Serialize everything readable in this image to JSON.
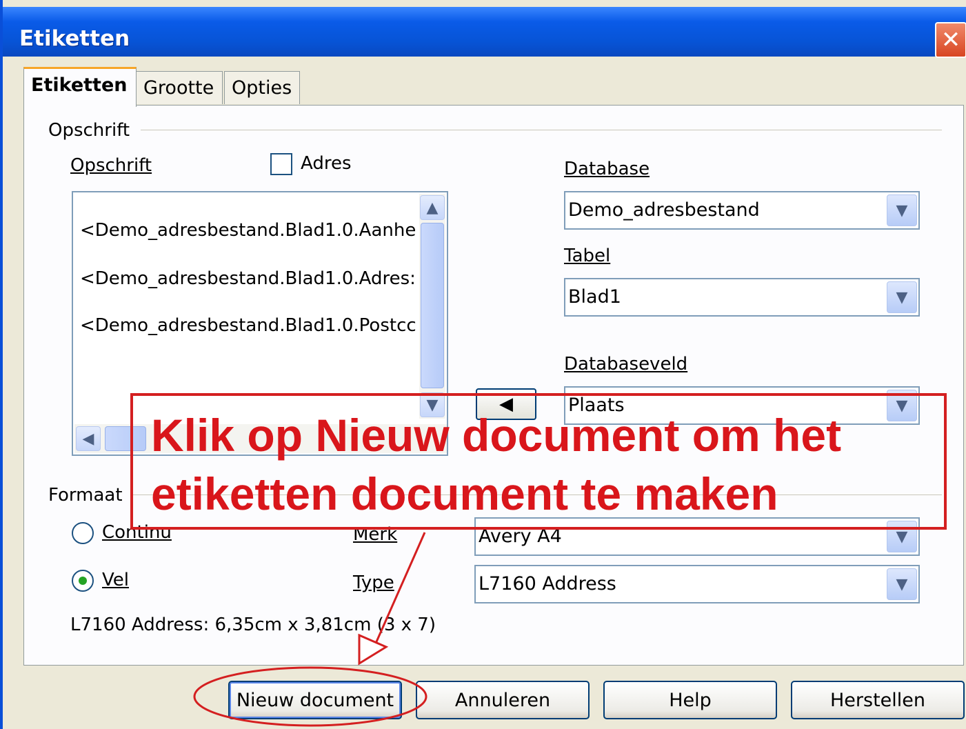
{
  "window": {
    "title": "Etiketten",
    "close_label": "✕"
  },
  "tabs": [
    {
      "label": "Etiketten",
      "active": true
    },
    {
      "label": "Grootte",
      "active": false
    },
    {
      "label": "Opties",
      "active": false
    }
  ],
  "opschrift_section": {
    "group_title": "Opschrift",
    "field_label": "Opschrift",
    "adres_label": "Adres",
    "adres_checked": false,
    "lines": [
      "<Demo_adresbestand.Blad1.0.Aanhe",
      "<Demo_adresbestand.Blad1.0.Adres:",
      "<Demo_adresbestand.Blad1.0.Postcc"
    ],
    "database_label": "Database",
    "database_value": "Demo_adresbestand",
    "tabel_label": "Tabel",
    "tabel_value": "Blad1",
    "databaseveld_label": "Databaseveld",
    "databaseveld_value": "Plaats",
    "insert_button_icon": "arrow-left-icon"
  },
  "formaat_section": {
    "group_title": "Formaat",
    "continu_label": "Continu",
    "vel_label": "Vel",
    "selected": "Vel",
    "merk_label": "Merk",
    "merk_value": "Avery A4",
    "type_label": "Type",
    "type_value": "L7160 Address",
    "info_text": "L7160 Address: 6,35cm x 3,81cm (3 x 7)"
  },
  "buttons": {
    "new_document": "Nieuw document",
    "cancel": "Annuleren",
    "help": "Help",
    "reset": "Herstellen"
  },
  "annotation": {
    "line1": "Klik op Nieuw document om het",
    "line2": "etiketten document te maken",
    "color": "#d9161b"
  },
  "icons": {
    "combo_arrow": "chevron-down-icon",
    "scroll_up": "chevron-up-icon",
    "scroll_down": "chevron-down-icon",
    "scroll_left": "chevron-left-icon"
  }
}
